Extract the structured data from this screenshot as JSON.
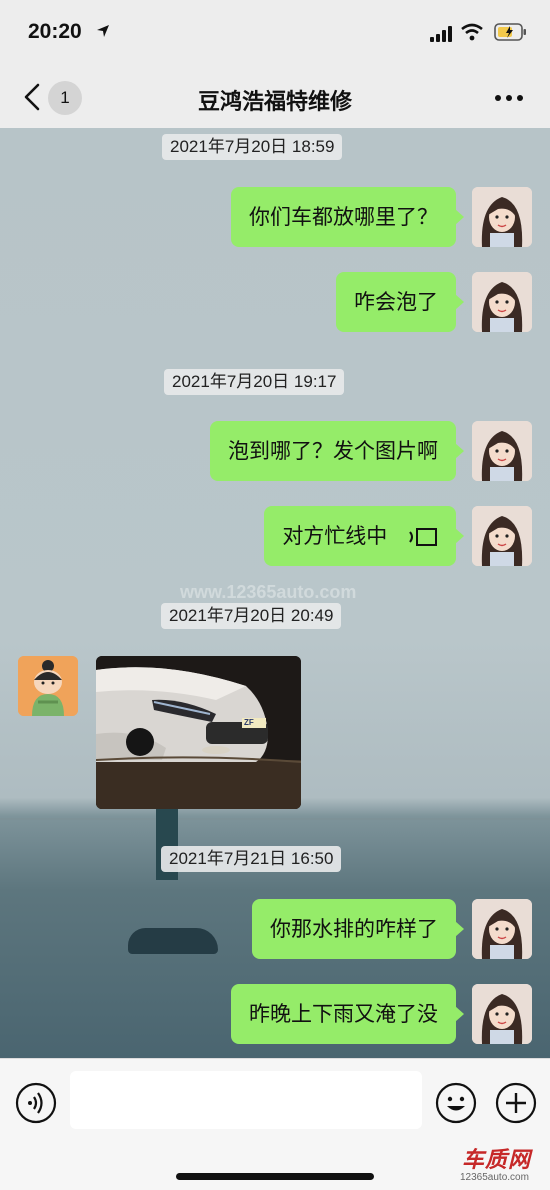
{
  "status": {
    "time": "20:20"
  },
  "nav": {
    "badge": "1",
    "title": "豆鸿浩福特维修"
  },
  "messages": {
    "ts1": "2021年7月20日 18:59",
    "m1": "你们车都放哪里了？",
    "m2": "咋会泡了",
    "ts2": "2021年7月20日 19:17",
    "m3": "泡到哪了？发个图片啊",
    "m4": "对方忙线中",
    "ts3": "2021年7月20日 20:49",
    "ts4": "2021年7月21日 16:50",
    "m5": "你那水排的咋样了",
    "m6": "昨晚上下雨又淹了没"
  },
  "photo": {
    "plate_text": "ZF"
  },
  "watermark": {
    "text": "www.12365auto.com"
  },
  "logo": {
    "main": "车质网",
    "sub": "12365auto.com"
  },
  "colors": {
    "bubble": "#95ec69",
    "background": "#ededed"
  }
}
